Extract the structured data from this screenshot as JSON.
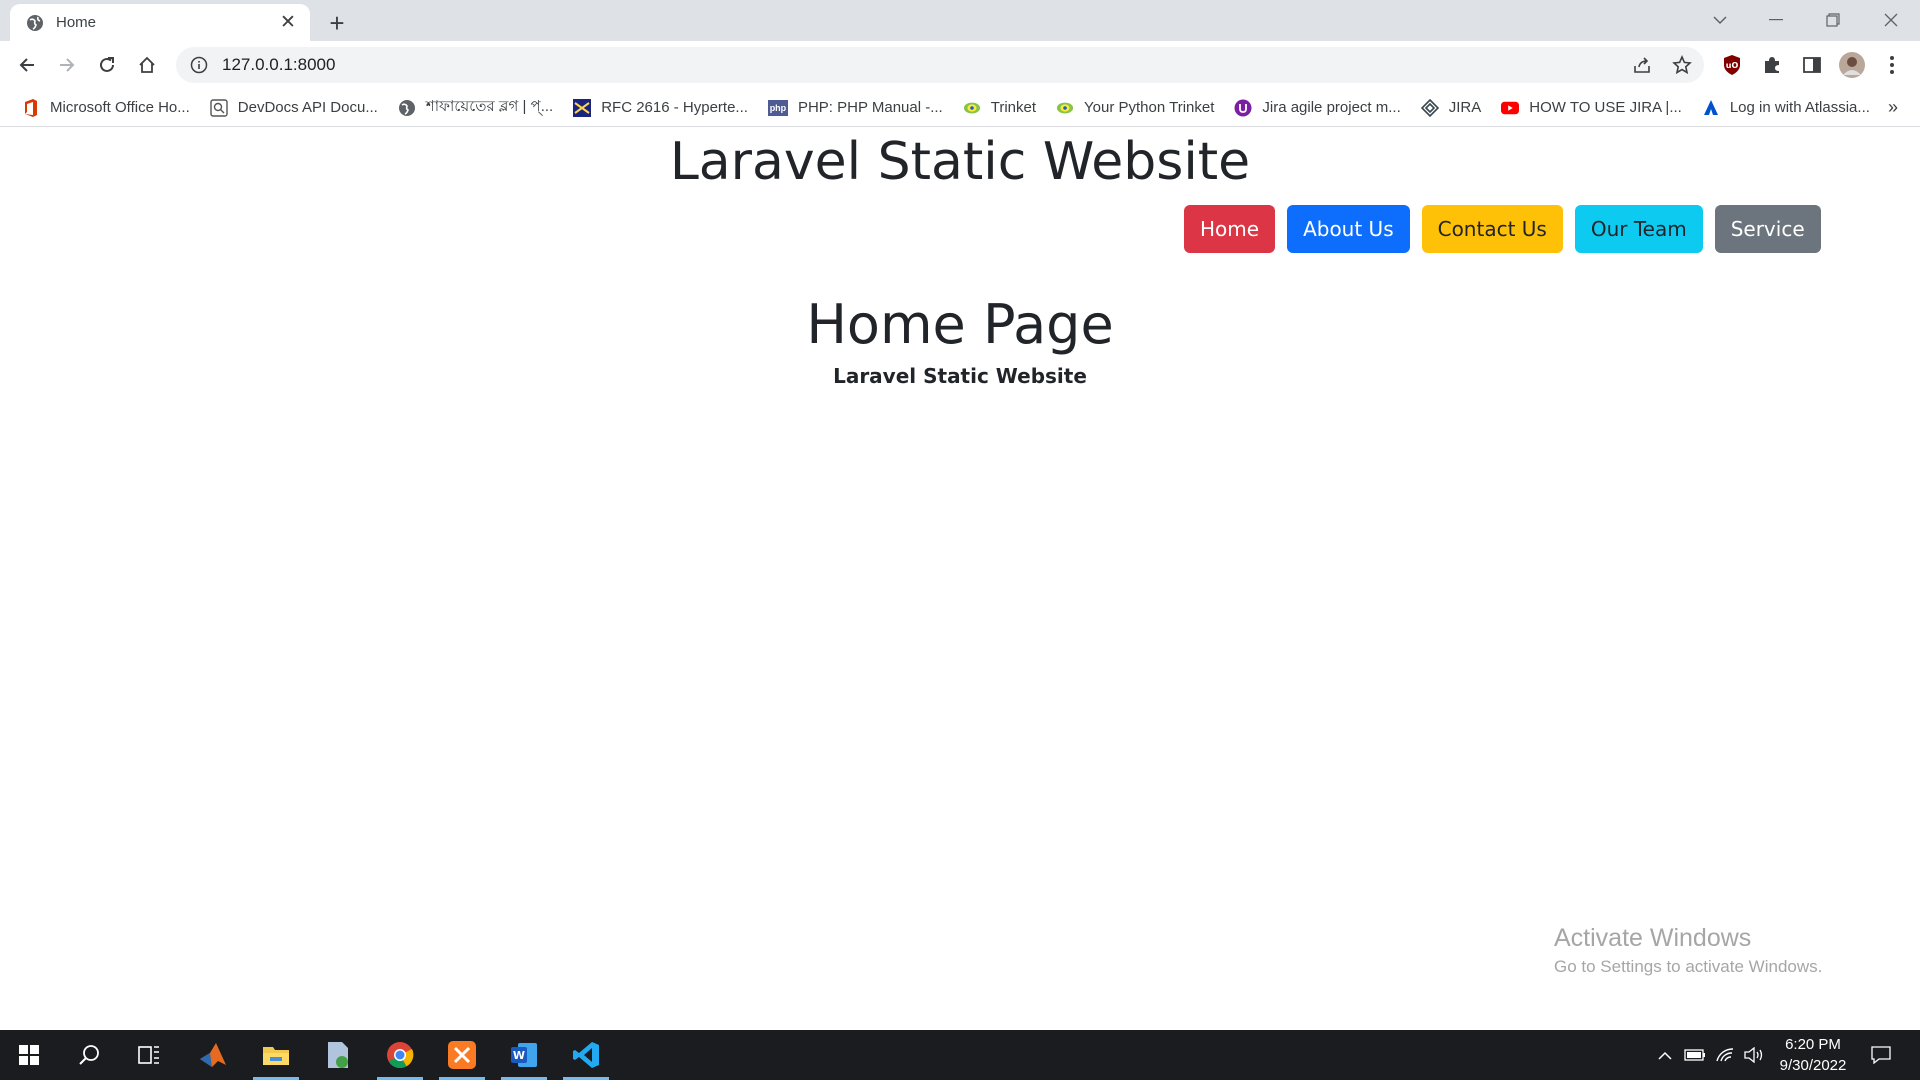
{
  "browser": {
    "tab_title": "Home",
    "url": "127.0.0.1:8000",
    "bookmarks": [
      {
        "label": "Microsoft Office Ho...",
        "icon": "office-icon",
        "color": "#d83b01"
      },
      {
        "label": "DevDocs API Docu...",
        "icon": "devdocs-icon",
        "color": "#555555"
      },
      {
        "label": "শাফায়েতের ব্লগ | প্...",
        "icon": "globe-icon",
        "color": "#5f6368"
      },
      {
        "label": "RFC 2616 - Hyperte...",
        "icon": "rfc-icon",
        "color": "#1a237e"
      },
      {
        "label": "PHP: PHP Manual -...",
        "icon": "php-icon",
        "color": "#4f5b93"
      },
      {
        "label": "Trinket",
        "icon": "trinket-icon",
        "color": "#8bc34a"
      },
      {
        "label": "Your Python Trinket",
        "icon": "trinket-icon",
        "color": "#8bc34a"
      },
      {
        "label": "Jira agile project m...",
        "icon": "jira-agile-icon",
        "color": "#7b1fa2"
      },
      {
        "label": "JIRA",
        "icon": "jira-icon",
        "color": "#37474f"
      },
      {
        "label": "HOW TO USE JIRA |...",
        "icon": "youtube-icon",
        "color": "#ff0000"
      },
      {
        "label": "Log in with Atlassia...",
        "icon": "atlassian-icon",
        "color": "#0052cc"
      }
    ],
    "more_bookmarks": "»"
  },
  "page": {
    "site_title": "Laravel Static Website",
    "nav": [
      {
        "label": "Home",
        "style": "red"
      },
      {
        "label": "About Us",
        "style": "blue"
      },
      {
        "label": "Contact Us",
        "style": "yellow"
      },
      {
        "label": "Our Team",
        "style": "cyan"
      },
      {
        "label": "Service",
        "style": "gray"
      }
    ],
    "heading": "Home Page",
    "subheading": "Laravel Static Website"
  },
  "watermark": {
    "line1": "Activate Windows",
    "line2": "Go to Settings to activate Windows."
  },
  "taskbar": {
    "time": "6:20 PM",
    "date": "9/30/2022",
    "apps": [
      "start-icon",
      "search-icon",
      "task-view-icon",
      "matlab-icon",
      "file-explorer-icon",
      "file-app-icon",
      "chrome-icon",
      "xampp-icon",
      "word-icon",
      "vscode-icon"
    ]
  },
  "colors": {
    "home_btn": "#dc3545",
    "about_btn": "#0d6efd",
    "contact_btn": "#ffc107",
    "team_btn": "#0dcaf0",
    "service_btn": "#6c757d"
  }
}
